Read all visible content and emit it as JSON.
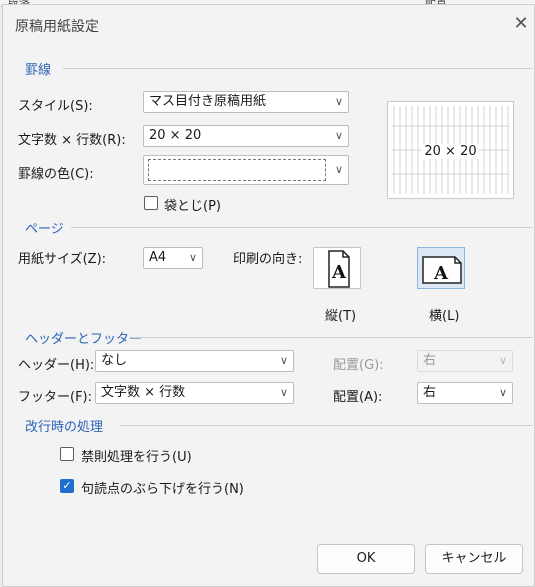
{
  "background_window": {
    "left_text": "段落",
    "right_text": "配置"
  },
  "title": "原稿用紙設定",
  "close_glyph": "✕",
  "ruled_section": {
    "label": "罫線",
    "style_label": "スタイル(S):",
    "style_value": "マス目付き原稿用紙",
    "chars_lines_label": "文字数 × 行数(R):",
    "chars_lines_value": "20 × 20",
    "line_color_label": "罫線の色(C):",
    "line_color_value": "",
    "fukuro_label": "袋とじ(P)",
    "fukuro_checked": false,
    "preview_text": "20 × 20"
  },
  "page_section": {
    "label": "ページ",
    "paper_size_label": "用紙サイズ(Z):",
    "paper_size_value": "A4",
    "orientation_label": "印刷の向き:",
    "portrait_label": "縦(T)",
    "landscape_label": "横(L)",
    "selected_orientation": "landscape",
    "orientation_glyph": "A"
  },
  "header_footer_section": {
    "label": "ヘッダーとフッター",
    "header_label": "ヘッダー(H):",
    "header_value": "なし",
    "header_align_label": "配置(G):",
    "header_align_value": "右",
    "header_align_disabled": true,
    "footer_label": "フッター(F):",
    "footer_value": "文字数 × 行数",
    "footer_align_label": "配置(A):",
    "footer_align_value": "右"
  },
  "line_break_section": {
    "label": "改行時の処理",
    "kinsoku_label": "禁則処理を行う(U)",
    "kinsoku_checked": false,
    "kutouten_label": "句読点のぶら下げを行う(N)",
    "kutouten_checked": true
  },
  "buttons": {
    "ok": "OK",
    "cancel": "キャンセル"
  },
  "icons": {
    "dropdown": "chevron-down-icon",
    "check": "checkmark-icon"
  }
}
